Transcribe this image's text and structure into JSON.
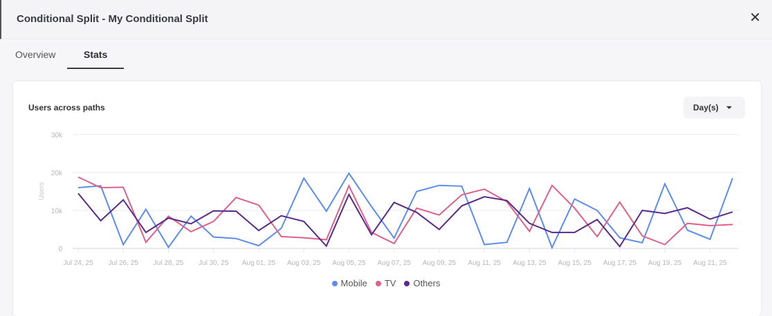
{
  "header": {
    "title": "Conditional Split - My Conditional Split",
    "close_icon": "close-icon"
  },
  "tabs": [
    {
      "label": "Overview",
      "active": false
    },
    {
      "label": "Stats",
      "active": true
    }
  ],
  "card": {
    "title": "Users across paths",
    "interval_select": "Day(s)"
  },
  "chart_data": {
    "type": "line",
    "title": "Users across paths",
    "xlabel": "",
    "ylabel": "Users",
    "ylim": [
      0,
      30000
    ],
    "yticks": [
      {
        "value": 0,
        "label": "0"
      },
      {
        "value": 10000,
        "label": "10k"
      },
      {
        "value": 20000,
        "label": "20k"
      },
      {
        "value": 30000,
        "label": "30k"
      }
    ],
    "grid": true,
    "legend": "bottom-center",
    "x": [
      "Jul 24, 25",
      "Jul 25, 25",
      "Jul 26, 25",
      "Jul 27, 25",
      "Jul 28, 25",
      "Jul 29, 25",
      "Jul 30, 25",
      "Jul 31, 25",
      "Aug 01, 25",
      "Aug 02, 25",
      "Aug 03, 25",
      "Aug 04, 25",
      "Aug 05, 25",
      "Aug 06, 25",
      "Aug 07, 25",
      "Aug 08, 25",
      "Aug 09, 25",
      "Aug 10, 25",
      "Aug 11, 25",
      "Aug 12, 25",
      "Aug 13, 25",
      "Aug 14, 25",
      "Aug 15, 25",
      "Aug 16, 25",
      "Aug 17, 25",
      "Aug 18, 25",
      "Aug 19, 25",
      "Aug 20, 25",
      "Aug 21, 25",
      "Aug 22, 25"
    ],
    "xtick_labels": [
      "Jul 24, 25",
      "Jul 26, 25",
      "Jul 28, 25",
      "Jul 30, 25",
      "Aug 01, 25",
      "Aug 03, 25",
      "Aug 05, 25",
      "Aug 07, 25",
      "Aug 09, 25",
      "Aug 11, 25",
      "Aug 13, 25",
      "Aug 15, 25",
      "Aug 17, 25",
      "Aug 19, 25",
      "Aug 21, 25"
    ],
    "series": [
      {
        "name": "Mobile",
        "color": "#5b8def",
        "values": [
          16000,
          16500,
          1000,
          10300,
          300,
          8500,
          3000,
          2600,
          700,
          5300,
          18500,
          9800,
          19800,
          11000,
          2700,
          15000,
          16600,
          16400,
          1000,
          1600,
          15800,
          200,
          13000,
          10000,
          2800,
          1500,
          17000,
          4800,
          2400,
          18500
        ]
      },
      {
        "name": "TV",
        "color": "#e0608a",
        "values": [
          18800,
          16000,
          16100,
          1600,
          8500,
          4400,
          7100,
          13400,
          11400,
          3100,
          2800,
          2300,
          16500,
          4200,
          1300,
          10600,
          8800,
          14100,
          15600,
          12300,
          4500,
          16600,
          10600,
          3100,
          12200,
          3300,
          1000,
          6600,
          6000,
          6300
        ]
      },
      {
        "name": "Others",
        "color": "#5a2a8a",
        "values": [
          14500,
          7300,
          12800,
          4200,
          8000,
          6500,
          9900,
          9800,
          4700,
          8600,
          7100,
          600,
          14200,
          3600,
          12100,
          9500,
          5000,
          11200,
          13600,
          12600,
          6600,
          4200,
          4200,
          7600,
          500,
          10000,
          9200,
          10700,
          7700,
          9600
        ]
      }
    ]
  }
}
